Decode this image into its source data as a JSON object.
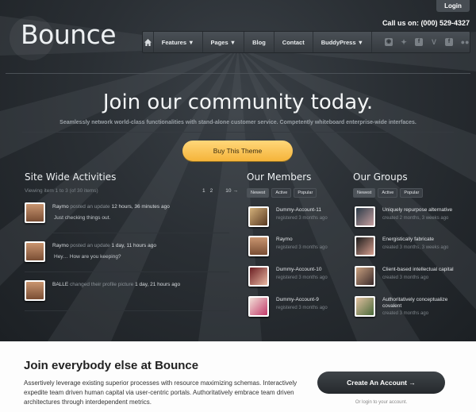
{
  "header": {
    "login": "Login",
    "logo": "Bounce",
    "call_us": "Call us on: (000) 529-4327",
    "nav": [
      "Features ▼",
      "Pages ▼",
      "Blog",
      "Contact",
      "BuddyPress ▼"
    ],
    "home_icon": "home-icon",
    "social_icons": [
      "rss-icon",
      "twitter-icon",
      "flickr-icon",
      "vimeo-icon",
      "facebook-icon",
      "flickr-dots-icon"
    ]
  },
  "hero": {
    "title": "Join our community today.",
    "subtitle": "Seamlessly network world-class functionalities with stand-alone customer service. Competently whiteboard enterprise-wide interfaces.",
    "button": "Buy This Theme"
  },
  "activities": {
    "title": "Site Wide Activities",
    "viewing": "Viewing item 1 to 3 (of 30 items)",
    "pager": [
      "1",
      "2",
      "10",
      "→"
    ],
    "items": [
      {
        "user": "Raymo",
        "action": " posted an update ",
        "time": "12 hours, 36 minutes ago",
        "body": "Just checking things out."
      },
      {
        "user": "Raymo",
        "action": " posted an update ",
        "time": "1 day, 11 hours ago",
        "body": "Hey… How are you keeping?"
      },
      {
        "user": "BALLE",
        "action": " changed their profile picture ",
        "time": "1 day, 21 hours ago",
        "body": ""
      }
    ]
  },
  "members": {
    "title": "Our Members",
    "tabs": [
      "Newest",
      "Active",
      "Popular"
    ],
    "items": [
      {
        "name": "Dummy-Account-11",
        "meta": "registered 3 months ago"
      },
      {
        "name": "Raymo",
        "meta": "registered 3 months ago"
      },
      {
        "name": "Dummy-Account-10",
        "meta": "registered 3 months ago"
      },
      {
        "name": "Dummy-Account-9",
        "meta": "registered 3 months ago"
      }
    ]
  },
  "groups": {
    "title": "Our Groups",
    "tabs": [
      "Newest",
      "Active",
      "Popular"
    ],
    "items": [
      {
        "name": "Uniquely repurpose alternative",
        "meta": "created 2 months, 3 weeks ago"
      },
      {
        "name": "Energistically fabricate",
        "meta": "created 3 months, 3 weeks ago"
      },
      {
        "name": "Client-based intellectual capital",
        "meta": "created 3 months ago"
      },
      {
        "name": "Authoritatively conceptualize",
        "name2": "covalent",
        "meta": "created 3 months ago"
      }
    ]
  },
  "bottom": {
    "title": "Join everybody else at Bounce",
    "text": "Assertively leverage existing superior processes with resource maximizing schemas. Interactively expedite team driven human capital via user-centric portals. Authoritatively embrace team driven architectures through interdependent metrics.",
    "button": "Create An Account →",
    "login_link": "Or login to your account."
  },
  "colors": {
    "accent": "#f5b43a",
    "dark": "#1e2226"
  }
}
